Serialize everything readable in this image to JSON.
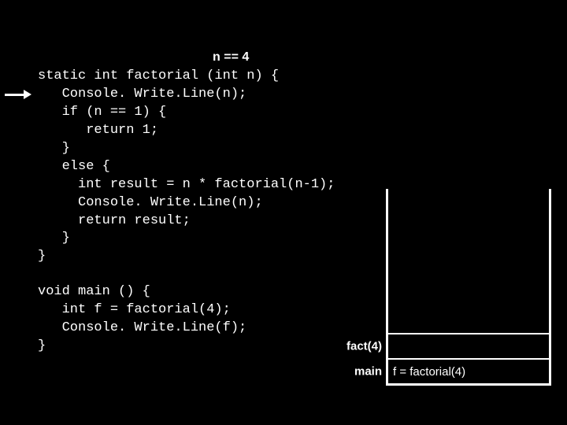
{
  "annotation": {
    "n_value": "n == 4"
  },
  "code": {
    "factorial": "static int factorial (int n) {\n   Console. Write.Line(n);\n   if (n == 1) {\n      return 1;\n   }\n   else {\n     int result = n * factorial(n-1);\n     Console. Write.Line(n);\n     return result;\n   }\n}",
    "main": "void main () {\n   int f = factorial(4);\n   Console. Write.Line(f);\n}"
  },
  "stack": {
    "frames": [
      {
        "label": "fact(4)",
        "content": ""
      },
      {
        "label": "main",
        "content": "f = factorial(4)"
      }
    ]
  }
}
